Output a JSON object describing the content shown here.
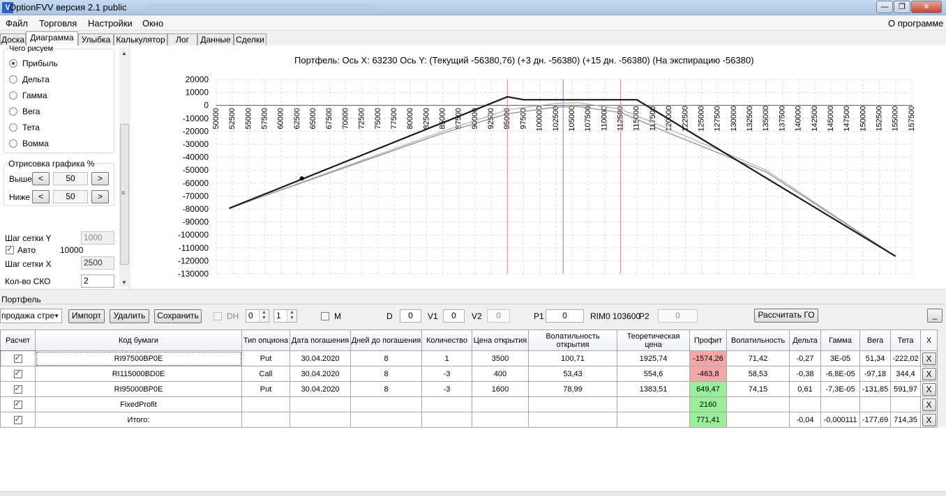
{
  "window": {
    "title": "OptionFVV версия 2.1 public"
  },
  "menu": {
    "file": "Файл",
    "trade": "Торговля",
    "settings": "Настройки",
    "window": "Окно",
    "about": "О программе"
  },
  "tabs": [
    "Доска",
    "Диаграмма",
    "Улыбка",
    "Калькулятор",
    "Лог",
    "Данные",
    "Сделки"
  ],
  "left": {
    "what_group": "Чего рисуем",
    "options": [
      "Прибыль",
      "Дельта",
      "Гамма",
      "Вега",
      "Тета",
      "Вомма"
    ],
    "selected": "Прибыль",
    "draw_group": "Отрисовка графика %",
    "above_label": "Выше",
    "below_label": "Ниже",
    "above_value": "50",
    "below_value": "50",
    "dec": "<",
    "inc": ">",
    "grid_y_label": "Шаг сетки Y",
    "grid_y_value": "1000",
    "auto_label": "Авто",
    "auto_value": "10000",
    "grid_x_label": "Шаг сетки X",
    "grid_x_value": "2500",
    "sko_label": "Кол-во СКО",
    "sko_value": "2"
  },
  "chart_title": "Портфель: Ось X: 63230 Ось Y:  (Текущий -56380,76)  (+3 дн. -56380)  (+15 дн. -56380)  (На экспирацию -56380)",
  "chart_data": {
    "type": "line",
    "title": "Портфель: Ось X: 63230 Ось Y:  (Текущий -56380,76)  (+3 дн. -56380)  (+15 дн. -56380)  (На экспирацию -56380)",
    "xlim": [
      50000,
      157500
    ],
    "ylim": [
      -130000,
      20000
    ],
    "x_ticks": [
      50000,
      52500,
      55000,
      57500,
      60000,
      62500,
      65000,
      67500,
      70000,
      72500,
      75000,
      77500,
      80000,
      82500,
      85000,
      87500,
      90000,
      92500,
      95000,
      97500,
      100000,
      102500,
      105000,
      107500,
      110000,
      112500,
      115000,
      117500,
      120000,
      122500,
      125000,
      127500,
      130000,
      132500,
      135000,
      137500,
      140000,
      142500,
      145000,
      147500,
      150000,
      152500,
      155000,
      157500
    ],
    "y_ticks": [
      20000,
      10000,
      0,
      -10000,
      -20000,
      -30000,
      -40000,
      -50000,
      -60000,
      -70000,
      -80000,
      -90000,
      -100000,
      -110000,
      -120000,
      -130000
    ],
    "grid": true,
    "series": [
      {
        "x": [
          52000,
          95000,
          97500,
          115000,
          155000
        ],
        "y": [
          -79500,
          6600,
          4300,
          4300,
          -116500
        ]
      },
      {
        "x": [
          52000,
          85000,
          95000,
          102500,
          106000,
          112500,
          120000,
          135000,
          155000
        ],
        "y": [
          -79500,
          -20000,
          -3500,
          1500,
          2000,
          -3000,
          -18500,
          -50000,
          -116500
        ]
      },
      {
        "x": [
          52000,
          85000,
          95000,
          102500,
          106000,
          112500,
          120000,
          135000,
          155000
        ],
        "y": [
          -79500,
          -21500,
          -6500,
          -1300,
          -1000,
          -5500,
          -21500,
          -51500,
          -116500
        ]
      }
    ],
    "markers": [
      {
        "x": 63230,
        "y": -56380
      }
    ],
    "vlines": [
      {
        "x": 95000,
        "color": "#f08080"
      },
      {
        "x": 103600,
        "color": "#8080c0"
      },
      {
        "x": 112500,
        "color": "#f08080"
      }
    ]
  },
  "portfolio": {
    "label": "Портфель",
    "combo": "продажа стре",
    "import": "Импорт",
    "delete": "Удалить",
    "save": "Сохранить",
    "dh": "DH",
    "spin1": "0",
    "spin2": "1",
    "m": "M",
    "d_label": "D",
    "d_value": "0",
    "v1_label": "V1",
    "v1_value": "0",
    "v2_label": "V2",
    "v2_value": "0",
    "p1_label": "P1",
    "p1_value": "0",
    "rim": "RIM0 103600",
    "p2_label": "P2",
    "p2_value": "0",
    "calc_go": "Рассчитать ГО",
    "minimize": "_"
  },
  "grid": {
    "headers": [
      "Расчет",
      "Код бумаги",
      "Тип опциона",
      "Дата погашения",
      "Дней до погашения",
      "Количество",
      "Цена открытия",
      "Волатильность открытия",
      "Теоретическая цена",
      "Профит",
      "Волатильность",
      "Дельта",
      "Гамма",
      "Вега",
      "Тета",
      "X"
    ],
    "rows": [
      [
        "RI97500BP0E",
        "Put",
        "30.04.2020",
        "8",
        "1",
        "3500",
        "100,71",
        "1925,74",
        "-1574,26",
        "71,42",
        "-0,27",
        "3E-05",
        "51,34",
        "-222,02"
      ],
      [
        "RI115000BD0E",
        "Call",
        "30.04.2020",
        "8",
        "-3",
        "400",
        "53,43",
        "554,6",
        "-463,8",
        "58,53",
        "-0,38",
        "-6,8E-05",
        "-97,18",
        "344,4"
      ],
      [
        "RI95000BP0E",
        "Put",
        "30.04.2020",
        "8",
        "-3",
        "1600",
        "78,99",
        "1383,51",
        "649,47",
        "74,15",
        "0,61",
        "-7,3E-05",
        "-131,85",
        "591,97"
      ],
      [
        "FixedProfit",
        "",
        "",
        "",
        "",
        "",
        "",
        "",
        "2160",
        "",
        "",
        "",
        "",
        ""
      ],
      [
        "Итого:",
        "",
        "",
        "",
        "",
        "",
        "",
        "",
        "771,41",
        "",
        "-0,04",
        "-0,000111",
        "-177,69",
        "714,35"
      ]
    ],
    "x_label": "X"
  }
}
